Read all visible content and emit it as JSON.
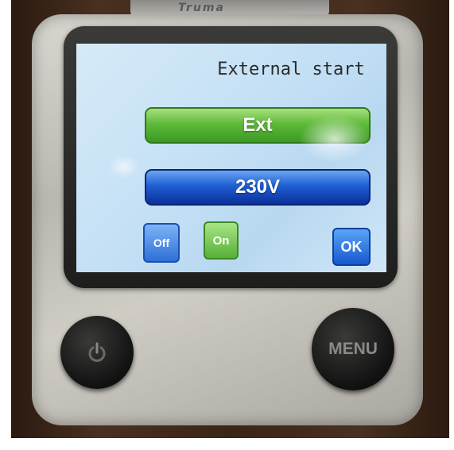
{
  "brand": "Truma",
  "screen": {
    "title": "External start",
    "mode_bar": "Ext",
    "voltage_bar": "230V",
    "off_button": "Off",
    "on_button": "On",
    "ok_button": "OK"
  },
  "hardware": {
    "menu_button": "MENU"
  },
  "colors": {
    "screen_bg": "#c4e0f5",
    "green_accent": "#5fba3a",
    "blue_accent": "#1f5fd4",
    "device_body": "#c9c6bf"
  }
}
